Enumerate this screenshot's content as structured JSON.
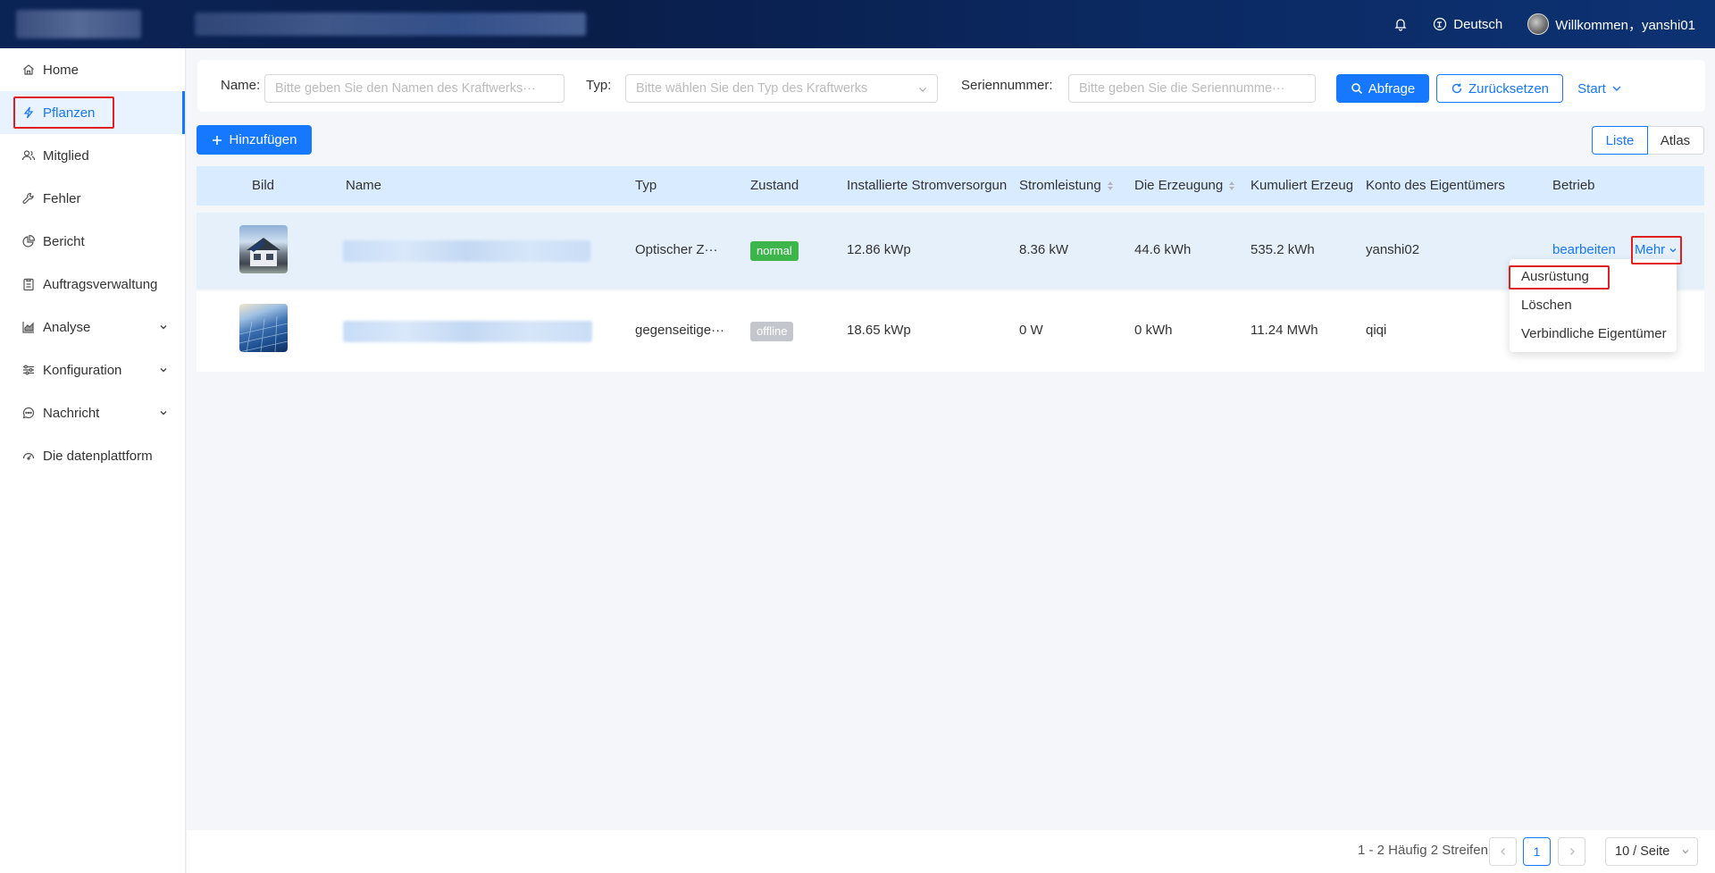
{
  "header": {
    "language": "Deutsch",
    "welcome": "Willkommen，yanshi01"
  },
  "sidebar": {
    "items": [
      {
        "label": "Home",
        "icon": "home-icon"
      },
      {
        "label": "Pflanzen",
        "icon": "lightning-icon",
        "active": true
      },
      {
        "label": "Mitglied",
        "icon": "users-icon"
      },
      {
        "label": "Fehler",
        "icon": "wrench-icon"
      },
      {
        "label": "Bericht",
        "icon": "pie-chart-icon"
      },
      {
        "label": "Auftragsverwaltung",
        "icon": "clipboard-icon"
      },
      {
        "label": "Analyse",
        "icon": "area-chart-icon",
        "expandable": true
      },
      {
        "label": "Konfiguration",
        "icon": "sliders-icon",
        "expandable": true
      },
      {
        "label": "Nachricht",
        "icon": "message-icon",
        "expandable": true
      },
      {
        "label": "Die datenplattform",
        "icon": "dashboard-icon"
      }
    ]
  },
  "filters": {
    "name_label": "Name:",
    "name_placeholder": "Bitte geben Sie den Namen des Kraftwerks···",
    "type_label": "Typ:",
    "type_placeholder": "Bitte wählen Sie den Typ des Kraftwerks",
    "serial_label": "Seriennummer:",
    "serial_placeholder": "Bitte geben Sie die Seriennumme···",
    "query_label": "Abfrage",
    "reset_label": "Zurücksetzen",
    "start_label": "Start"
  },
  "toolbar": {
    "add_label": "Hinzufügen",
    "view_list": "Liste",
    "view_atlas": "Atlas"
  },
  "table": {
    "columns": [
      "Bild",
      "Name",
      "Typ",
      "Zustand",
      "Installierte Stromversorgun",
      "Stromleistung",
      "Die Erzeugung",
      "Kumuliert Erzeug",
      "Konto des Eigentümers",
      "Betrieb"
    ],
    "rows": [
      {
        "type": "Optischer Z···",
        "status": "normal",
        "installed": "12.86 kWp",
        "power": "8.36 kW",
        "generation": "44.6 kWh",
        "cumulative": "535.2 kWh",
        "owner": "yanshi02"
      },
      {
        "type": "gegenseitige···",
        "status": "offline",
        "installed": "18.65 kWp",
        "power": "0 W",
        "generation": "0 kWh",
        "cumulative": "11.24 MWh",
        "owner": "qiqi"
      }
    ],
    "action_edit": "bearbeiten",
    "action_more": "Mehr"
  },
  "more_menu": {
    "items": [
      "Ausrüstung",
      "Löschen",
      "Verbindliche Eigentümer"
    ]
  },
  "pagination": {
    "summary": "1 - 2 Häufig 2 Streifen",
    "current_page": "1",
    "page_size": "10 / Seite"
  },
  "colors": {
    "primary": "#1677ff",
    "header_bg": "#0b2456",
    "status_normal": "#3cb64b",
    "status_offline": "#c3c7cd",
    "highlight": "#e02020"
  }
}
